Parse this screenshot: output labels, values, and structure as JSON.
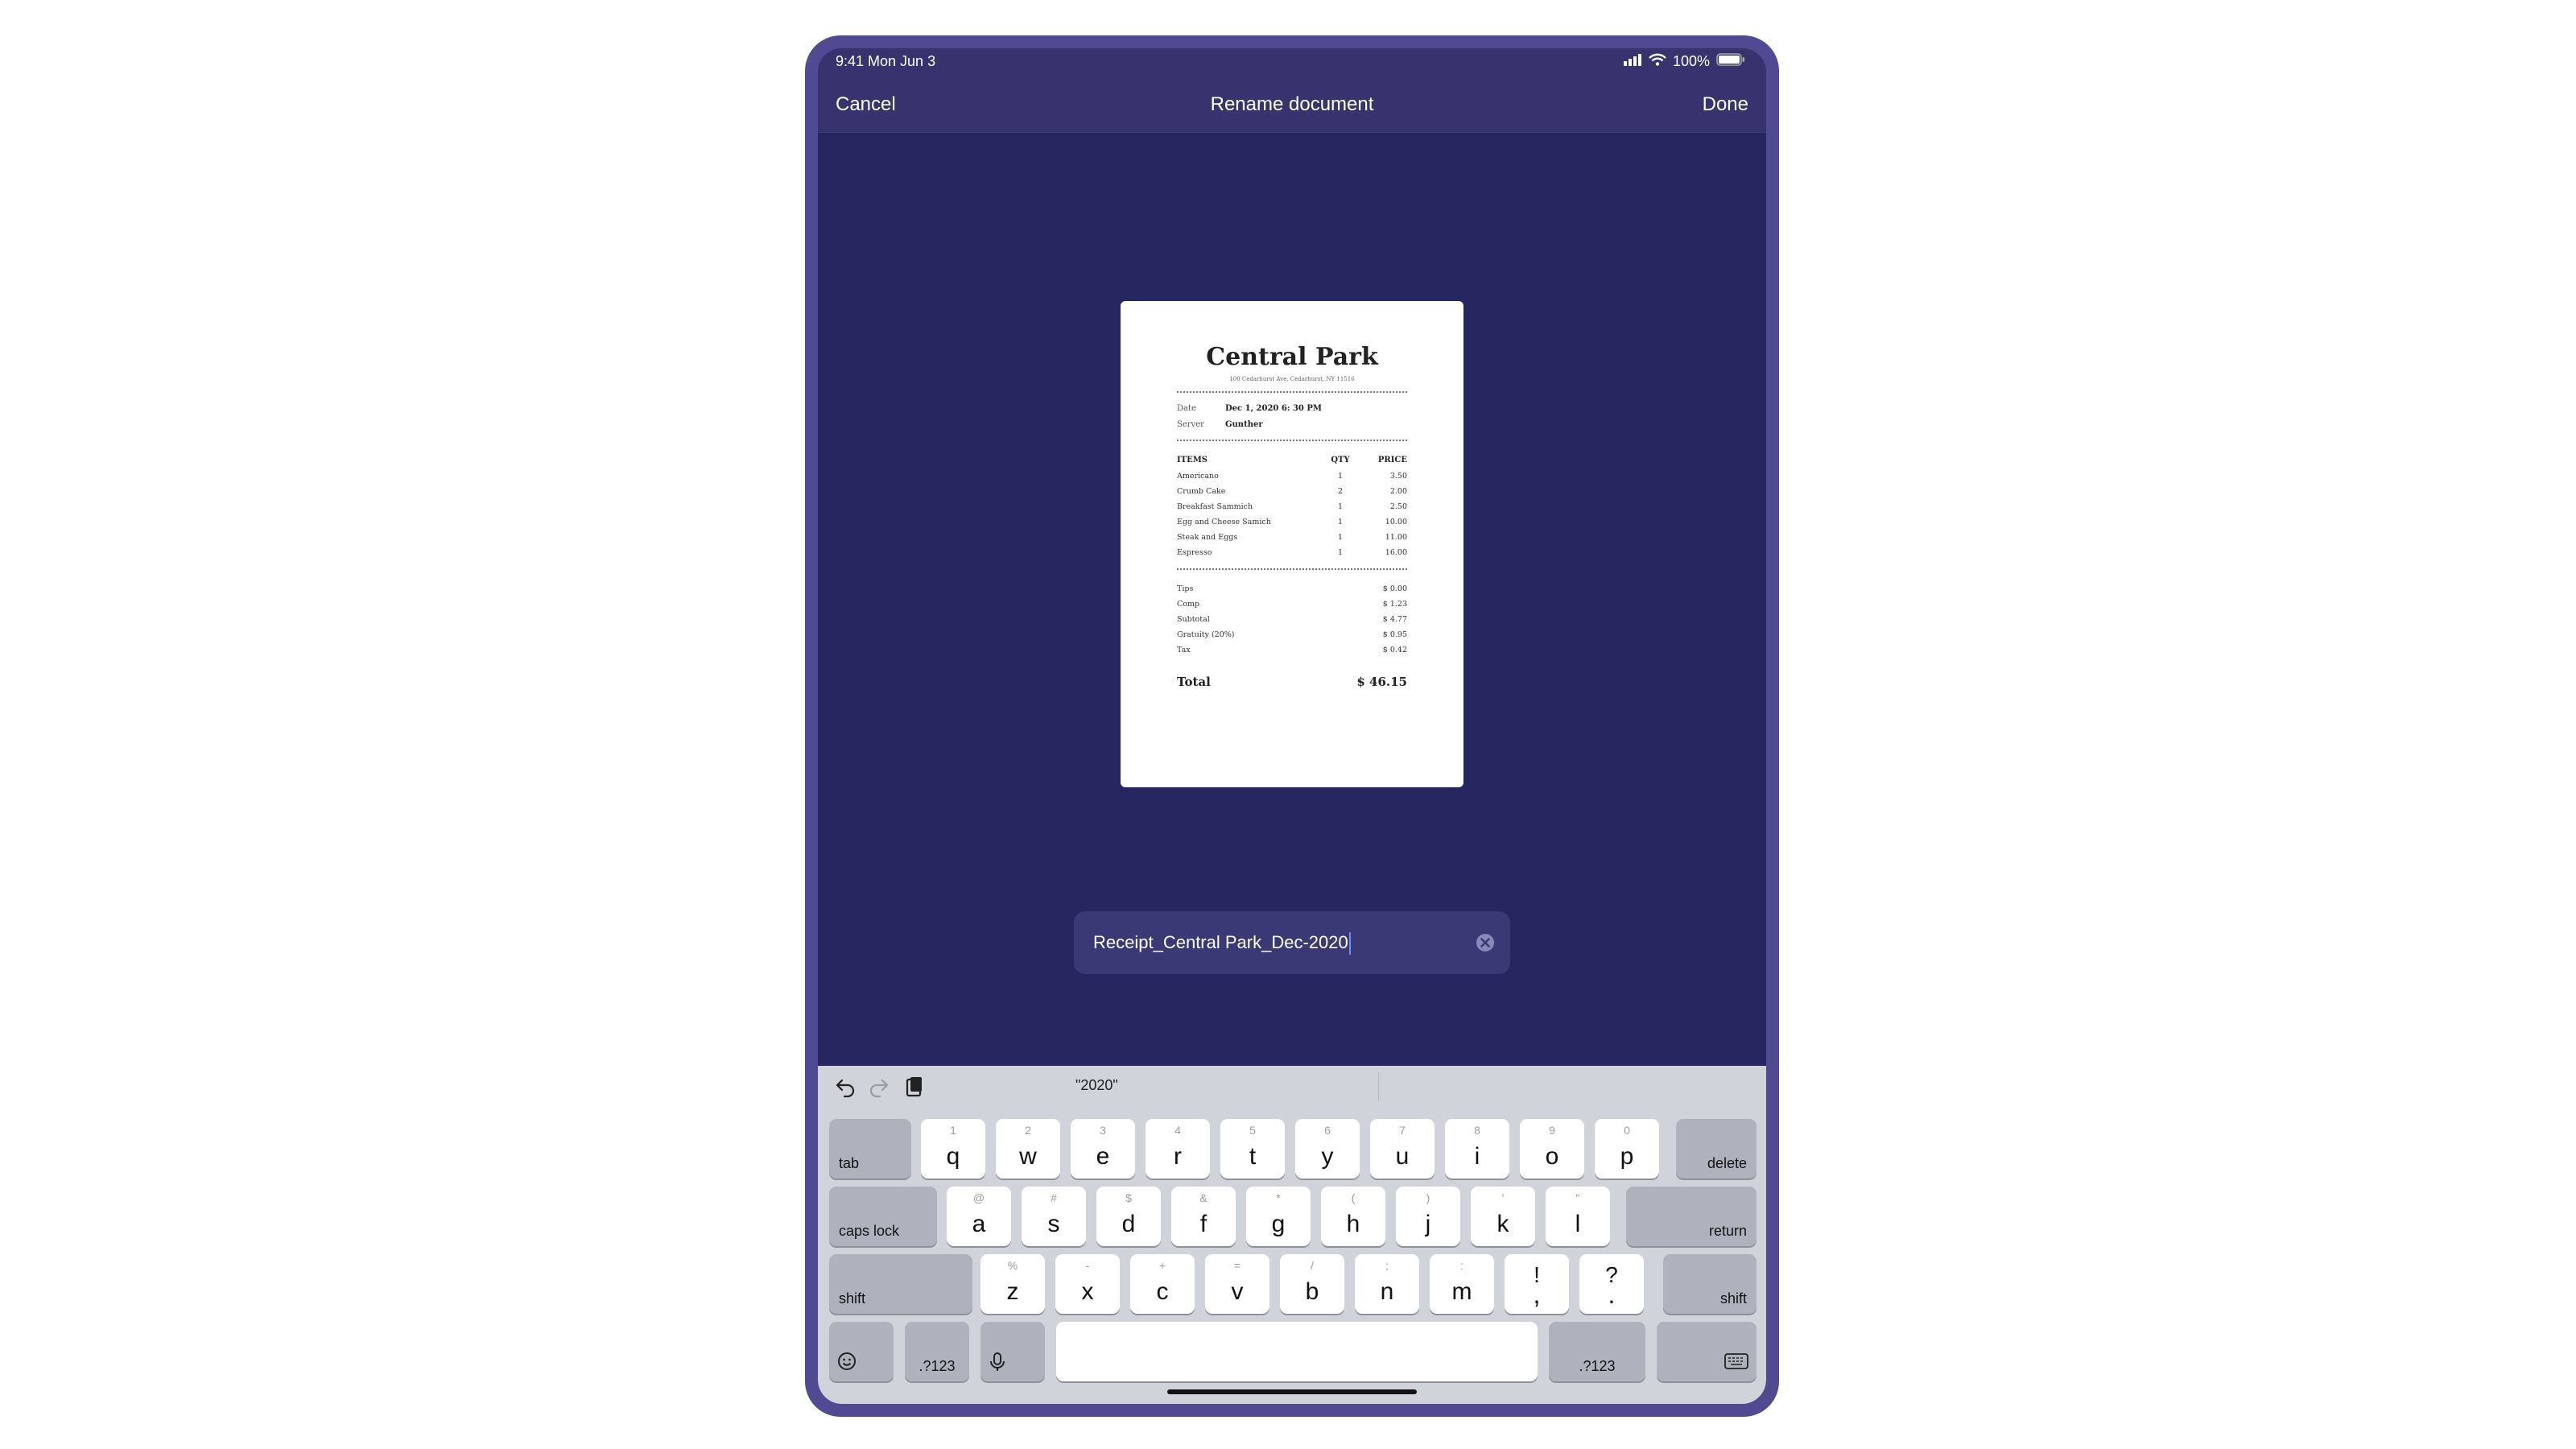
{
  "status_bar": {
    "time_date": "9:41  Mon Jun 3",
    "battery": "100%"
  },
  "nav": {
    "cancel_label": "Cancel",
    "title": "Rename document",
    "done_label": "Done"
  },
  "receipt": {
    "title": "Central Park",
    "address": "100 Cedarhurst Ave, Cedarhurst, NY 11516",
    "date_label": "Date",
    "date_value": "Dec 1, 2020 6: 30 PM",
    "server_label": "Server",
    "server_value": "Gunther",
    "headers": {
      "items": "ITEMS",
      "qty": "QTY",
      "price": "PRICE"
    },
    "items": [
      {
        "name": "Americano",
        "qty": "1",
        "price": "3.50"
      },
      {
        "name": "Crumb Cake",
        "qty": "2",
        "price": "2.00"
      },
      {
        "name": "Breakfast Sammich",
        "qty": "1",
        "price": "2.50"
      },
      {
        "name": "Egg and Cheese  Samich",
        "qty": "1",
        "price": "10.00"
      },
      {
        "name": "Steak and Eggs",
        "qty": "1",
        "price": "11.00"
      },
      {
        "name": "Espresso",
        "qty": "1",
        "price": "16.00"
      }
    ],
    "summary": [
      {
        "label": "Tips",
        "value": "$ 0.00"
      },
      {
        "label": "Comp",
        "value": "$ 1.23"
      },
      {
        "label": "Subtotal",
        "value": "$ 4.77"
      },
      {
        "label": "Gratuity (20%)",
        "value": "$ 0.95"
      },
      {
        "label": "Tax",
        "value": "$ 0.42"
      }
    ],
    "total_label": "Total",
    "total_value": "$ 46.15"
  },
  "filename_field": {
    "value": "Receipt_Central Park_Dec-2020"
  },
  "keyboard": {
    "suggestion": "\"2020\"",
    "row1": [
      {
        "main": "q",
        "alt": "1"
      },
      {
        "main": "w",
        "alt": "2"
      },
      {
        "main": "e",
        "alt": "3"
      },
      {
        "main": "r",
        "alt": "4"
      },
      {
        "main": "t",
        "alt": "5"
      },
      {
        "main": "y",
        "alt": "6"
      },
      {
        "main": "u",
        "alt": "7"
      },
      {
        "main": "i",
        "alt": "8"
      },
      {
        "main": "o",
        "alt": "9"
      },
      {
        "main": "p",
        "alt": "0"
      }
    ],
    "row2": [
      {
        "main": "a",
        "alt": "@"
      },
      {
        "main": "s",
        "alt": "#"
      },
      {
        "main": "d",
        "alt": "$"
      },
      {
        "main": "f",
        "alt": "&"
      },
      {
        "main": "g",
        "alt": "*"
      },
      {
        "main": "h",
        "alt": "("
      },
      {
        "main": "j",
        "alt": ")"
      },
      {
        "main": "k",
        "alt": "'"
      },
      {
        "main": "l",
        "alt": "\""
      }
    ],
    "row3": [
      {
        "main": "z",
        "alt": "%"
      },
      {
        "main": "x",
        "alt": "-"
      },
      {
        "main": "c",
        "alt": "+"
      },
      {
        "main": "v",
        "alt": "="
      },
      {
        "main": "b",
        "alt": "/"
      },
      {
        "main": "n",
        "alt": ";"
      },
      {
        "main": "m",
        "alt": ":"
      }
    ],
    "punct": [
      {
        "top": "!",
        "bottom": ","
      },
      {
        "top": "?",
        "bottom": "."
      }
    ],
    "tab_label": "tab",
    "delete_label": "delete",
    "caps_label": "caps lock",
    "return_label": "return",
    "shift_label": "shift",
    "numbers_label": ".?123"
  }
}
